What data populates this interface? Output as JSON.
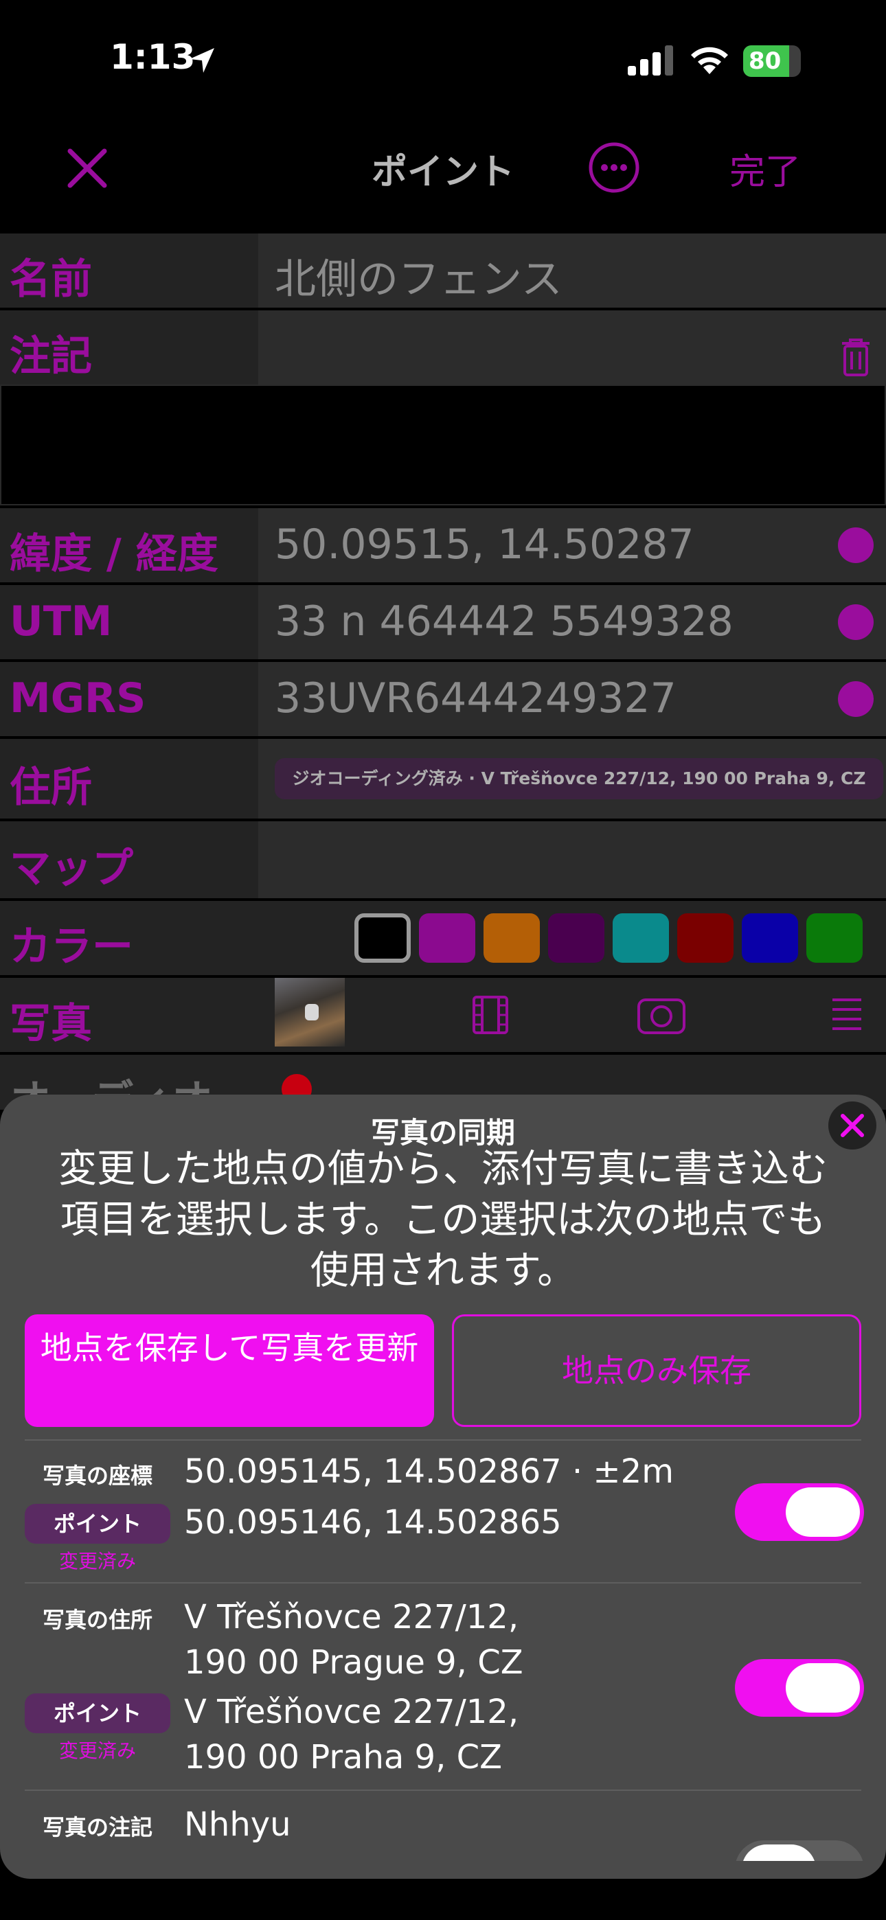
{
  "status": {
    "time": "1:13",
    "battery": "80",
    "battery_level": 0.8
  },
  "nav": {
    "title": "ポイント",
    "done": "完了"
  },
  "form": {
    "name_label": "名前",
    "name_value": "北側のフェンス",
    "note_label": "注記",
    "latlon_label": "緯度 / 経度",
    "latlon_value": "50.09515, 14.50287",
    "utm_label": "UTM",
    "utm_value": "33 n 464442 5549328",
    "mgrs_label": "MGRS",
    "mgrs_value": "33UVR6444249327",
    "address_label": "住所",
    "address_value": "ジオコーディング済み · V Třešňovce 227/12, 190 00 Praha 9, CZ",
    "map_label": "マップ",
    "color_label": "カラー",
    "colors": [
      "#000000",
      "#8b0a8f",
      "#b45f06",
      "#4a004f",
      "#0a8a8c",
      "#7a0000",
      "#0a00a8",
      "#0a7a0a"
    ],
    "photo_label": "写真",
    "audio_label": "オーディオ"
  },
  "sheet": {
    "title": "写真の同期",
    "message": "変更した地点の値から、添付写真に書き込む項目を選択します。この選択は次の地点でも使用されます。",
    "primary_button": "地点を保存して写真を更新",
    "secondary_button": "地点のみ保存",
    "items": [
      {
        "label": "写真の座標",
        "photo_value": "50.095145, 14.502867 · ±2m",
        "point_label": "ポイント",
        "changed": "変更済み",
        "point_value": "50.095146, 14.502865"
      },
      {
        "label": "写真の住所",
        "photo_value_line1": "V Třešňovce 227/12,",
        "photo_value_line2": "190 00 Prague 9, CZ",
        "point_label": "ポイント",
        "changed": "変更済み",
        "point_value_line1": "V Třešňovce 227/12,",
        "point_value_line2": "190 00 Praha 9, CZ"
      },
      {
        "label": "写真の注記",
        "photo_value": "Nhhyu"
      }
    ]
  }
}
